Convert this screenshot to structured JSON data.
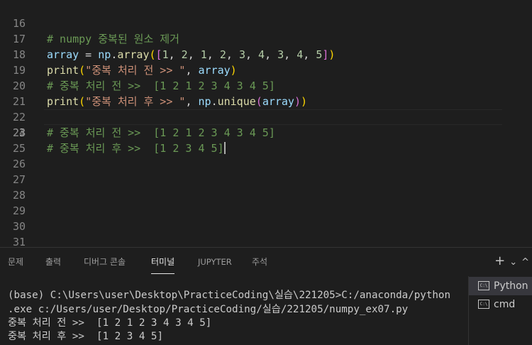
{
  "editor": {
    "line_numbers": [
      "16",
      "17",
      "18",
      "19",
      "20",
      "21",
      "22",
      "23",
      "24",
      "25",
      "26",
      "27",
      "28",
      "29",
      "30",
      "31"
    ],
    "active_line": "23",
    "lines": {
      "l16": {
        "comment": "# numpy 중복된 원소 제거"
      },
      "l17": {
        "var": "array",
        "eq": " = ",
        "mod": "np",
        "dot": ".",
        "fn": "array",
        "open_paren": "(",
        "open_bracket": "[",
        "nums": [
          "1",
          "2",
          "1",
          "2",
          "3",
          "4",
          "3",
          "4",
          "5"
        ],
        "sep": ", ",
        "close_bracket": "]",
        "close_paren": ")"
      },
      "l18": {
        "fn": "print",
        "open": "(",
        "str": "\"중복 처리 전 >> \"",
        "comma": ", ",
        "var": "array",
        "close": ")"
      },
      "l19": {
        "comment": "# 중복 처리 전 >>  [1 2 1 2 3 4 3 4 5]"
      },
      "l20": {
        "fn": "print",
        "open": "(",
        "str": "\"중복 처리 후 >> \"",
        "comma": ", ",
        "mod": "np",
        "dot": ".",
        "fn2": "unique",
        "open2": "(",
        "var": "array",
        "close2": ")",
        "close": ")"
      },
      "l22": {
        "comment": "# 중복 처리 전 >>  [1 2 1 2 3 4 3 4 5]"
      },
      "l23": {
        "comment": "# 중복 처리 후 >>  [1 2 3 4 5]"
      }
    }
  },
  "panel": {
    "tabs": [
      "문제",
      "출력",
      "디버그 콘솔",
      "터미널",
      "JUPYTER",
      "주석"
    ],
    "active_tab": "터미널",
    "actions": {
      "add": "+",
      "dropdown": "⌄",
      "more": "^"
    }
  },
  "terminal": {
    "lines": [
      "(base) C:\\Users\\user\\Desktop\\PracticeCoding\\실습\\221205>C:/anaconda/python",
      ".exe c:/Users/user/Desktop/PracticeCoding/실습/221205/numpy_ex07.py",
      "중복 처리 전 >>  [1 2 1 2 3 4 3 4 5]",
      "중복 처리 후 >>  [1 2 3 4 5]"
    ],
    "instances": [
      {
        "icon_text": "C:\\",
        "label": "Python"
      },
      {
        "icon_text": "C:\\",
        "label": "cmd"
      }
    ]
  },
  "colors": {
    "background": "#1e1e1e",
    "comment": "#6a9955",
    "variable": "#9cdcfe",
    "function": "#dcdcaa",
    "number": "#b5cea8",
    "string": "#ce9178",
    "bracket_level1": "#ffd700",
    "bracket_level2": "#da70d6",
    "bracket_level3": "#179fff"
  }
}
